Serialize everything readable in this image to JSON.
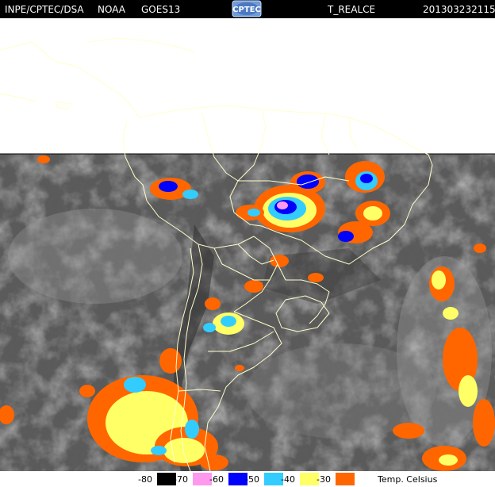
{
  "header": {
    "source": "INPE/CPTEC/DSA",
    "agency": "NOAA",
    "satellite": "GOES13",
    "logo_text": "CPTEC",
    "product": "T_REALCE",
    "timestamp": "201303232115"
  },
  "legend": {
    "unit": "Temp. Celsius",
    "items": [
      {
        "label": "-80",
        "color": "#000000"
      },
      {
        "label": "-70",
        "color": "#ff99ee"
      },
      {
        "label": "-60",
        "color": "#0000ff"
      },
      {
        "label": "-50",
        "color": "#33ccff"
      },
      {
        "label": "-40",
        "color": "#ffff66"
      },
      {
        "label": "-30",
        "color": "#ff6600"
      }
    ]
  }
}
